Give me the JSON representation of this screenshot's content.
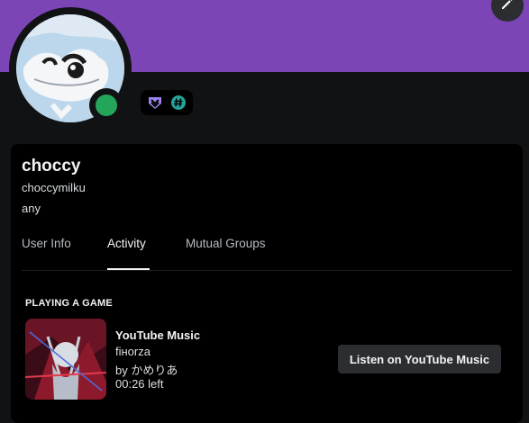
{
  "colors": {
    "banner": "#7b45b5",
    "status_online": "#23a55a",
    "card_bg": "#000000",
    "page_bg": "#111214"
  },
  "profile": {
    "display_name": "choccy",
    "username": "choccymilku",
    "pronouns": "any",
    "status": "online",
    "badges": [
      "hypesquad-icon",
      "hashtag-icon"
    ]
  },
  "tabs": [
    {
      "label": "User Info",
      "active": false
    },
    {
      "label": "Activity",
      "active": true
    },
    {
      "label": "Mutual Groups",
      "active": false
    }
  ],
  "activity": {
    "section_title": "PLAYING A GAME",
    "app": "YouTube Music",
    "song": "fiнorza",
    "artist": "by かめりあ",
    "time_left": "00:26 left",
    "button_label": "Listen on YouTube Music"
  }
}
